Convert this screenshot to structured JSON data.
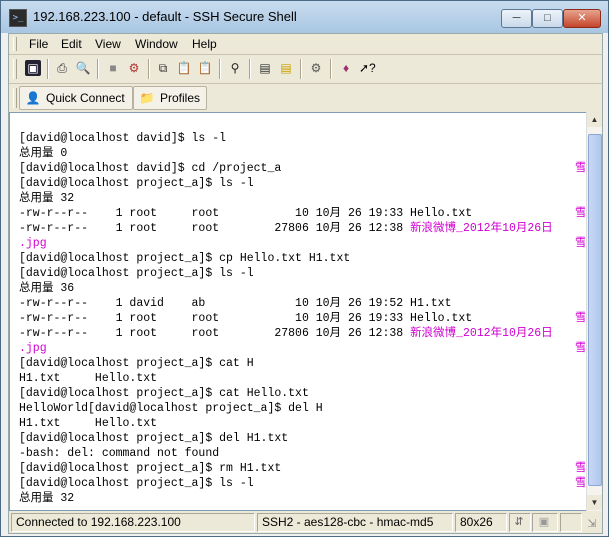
{
  "window": {
    "title": "192.168.223.100 - default - SSH Secure Shell",
    "app_icon": "ssh-terminal-icon",
    "controls": {
      "minimize": "minimize-icon",
      "maximize": "maximize-icon",
      "close": "close-icon"
    }
  },
  "menu": [
    "File",
    "Edit",
    "View",
    "Window",
    "Help"
  ],
  "toolbar": {
    "icons": [
      "save-icon",
      "print-icon",
      "print-preview-icon",
      "disconnect-icon",
      "settings-icon",
      "copy-icon",
      "paste-icon",
      "paste-disabled-icon",
      "find-icon",
      "new-terminal-icon",
      "new-file-transfer-icon",
      "profiles-icon",
      "keys-icon",
      "help-pointer-icon"
    ]
  },
  "quickbar": {
    "quick_connect": "Quick Connect",
    "profiles": "Profiles",
    "quick_connect_icon": "user-icon",
    "profiles_icon": "folder-icon"
  },
  "terminal": {
    "lines": [
      {
        "text": "[david@localhost david]$ ls -l"
      },
      {
        "text": "总用量 0"
      },
      {
        "text": "[david@localhost david]$ cd /project_a",
        "mark": "雪"
      },
      {
        "text": "[david@localhost project_a]$ ls -l"
      },
      {
        "text": "总用量 32"
      },
      {
        "text": "-rw-r--r--    1 root     root           10 10月 26 19:33 Hello.txt",
        "mark": "雪"
      },
      {
        "text": "-rw-r--r--    1 root     root        27806 10月 26 12:38 ",
        "hl": "新浪微博_2012年10月26日"
      },
      {
        "text": "",
        "hl": ".jpg",
        "mark": "雪"
      },
      {
        "text": "[david@localhost project_a]$ cp Hello.txt H1.txt"
      },
      {
        "text": "[david@localhost project_a]$ ls -l"
      },
      {
        "text": "总用量 36"
      },
      {
        "text": "-rw-r--r--    1 david    ab             10 10月 26 19:52 H1.txt"
      },
      {
        "text": "-rw-r--r--    1 root     root           10 10月 26 19:33 Hello.txt",
        "mark": "雪"
      },
      {
        "text": "-rw-r--r--    1 root     root        27806 10月 26 12:38 ",
        "hl": "新浪微博_2012年10月26日"
      },
      {
        "text": "",
        "hl": ".jpg",
        "mark": "雪"
      },
      {
        "text": "[david@localhost project_a]$ cat H"
      },
      {
        "text": "H1.txt     Hello.txt"
      },
      {
        "text": "[david@localhost project_a]$ cat Hello.txt"
      },
      {
        "text": "HelloWorld[david@localhost project_a]$ del H"
      },
      {
        "text": "H1.txt     Hello.txt"
      },
      {
        "text": "[david@localhost project_a]$ del H1.txt"
      },
      {
        "text": "-bash: del: command not found"
      },
      {
        "text": "[david@localhost project_a]$ rm H1.txt",
        "mark": "雪"
      },
      {
        "text": "[david@localhost project_a]$ ls -l",
        "mark": "雪"
      },
      {
        "text": "总用量 32"
      }
    ],
    "highlight_color": "#d000d0"
  },
  "status": {
    "connection": "Connected to 192.168.223.100",
    "cipher": "SSH2 - aes128-cbc - hmac-md5",
    "size": "80x26",
    "icons": [
      "transfer-icon",
      "lock-icon",
      "resize-grip-icon"
    ]
  }
}
